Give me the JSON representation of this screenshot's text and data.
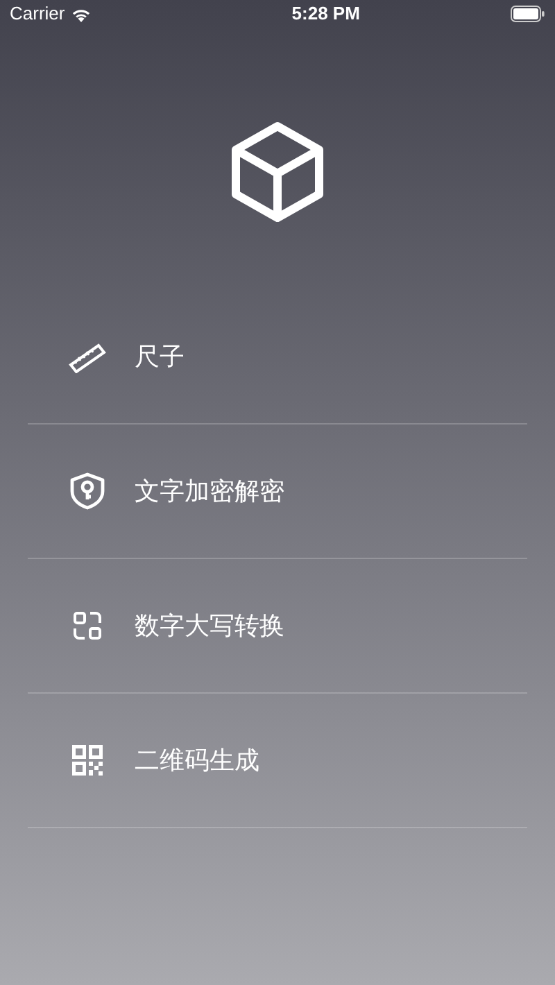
{
  "status_bar": {
    "carrier": "Carrier",
    "time": "5:28 PM"
  },
  "menu": [
    {
      "kind": "ruler",
      "label": "尺子"
    },
    {
      "kind": "shield",
      "label": "文字加密解密"
    },
    {
      "kind": "convert",
      "label": "数字大写转换"
    },
    {
      "kind": "qrcode",
      "label": "二维码生成"
    }
  ]
}
